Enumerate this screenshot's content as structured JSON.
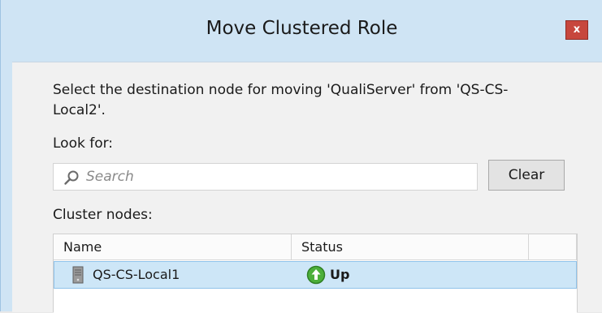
{
  "window": {
    "title": "Move Clustered Role",
    "close_label": "x"
  },
  "dialog": {
    "instruction": "Select the destination node for moving 'QualiServer' from 'QS-CS-Local2'.",
    "look_for_label": "Look for:",
    "search": {
      "placeholder": "Search",
      "value": ""
    },
    "clear_label": "Clear",
    "cluster_nodes_label": "Cluster nodes:"
  },
  "table": {
    "columns": [
      "Name",
      "Status",
      ""
    ],
    "rows": [
      {
        "name": "QS-CS-Local1",
        "status": "Up",
        "icon": "server-icon",
        "status_icon": "up-arrow-icon",
        "selected": true
      }
    ]
  },
  "colors": {
    "titlebar_bg": "#cfe4f4",
    "close_button": "#c7473d",
    "selection_bg": "#cde6f7",
    "status_up": "#4caf3a"
  }
}
